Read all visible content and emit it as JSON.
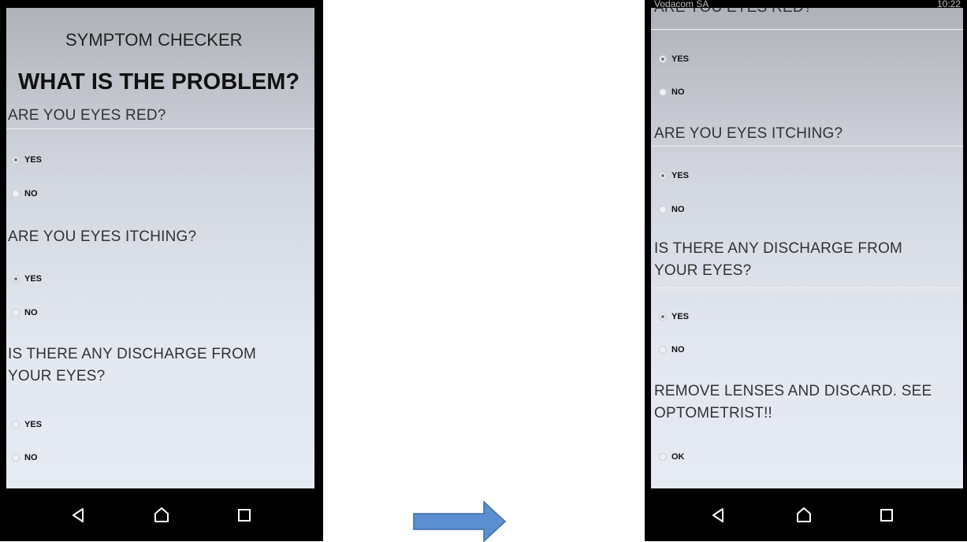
{
  "left_screen": {
    "app_title": "SYMPTOM CHECKER",
    "heading": "WHAT IS THE PROBLEM?",
    "q1": {
      "text": "ARE YOU EYES RED?",
      "opt_yes": "YES",
      "opt_no": "NO",
      "selected": "YES"
    },
    "q2": {
      "text": "ARE YOU EYES ITCHING?",
      "opt_yes": "YES",
      "opt_no": "NO",
      "selected": "YES"
    },
    "q3": {
      "text": "IS THERE ANY DISCHARGE FROM YOUR EYES?",
      "opt_yes": "YES",
      "opt_no": "NO",
      "selected": null
    }
  },
  "right_screen": {
    "status_bar": {
      "carrier": "Vodacom SA",
      "time": "10:22"
    },
    "q1": {
      "text": "ARE YOU EYES RED?",
      "opt_yes": "YES",
      "opt_no": "NO",
      "selected": "YES"
    },
    "q2": {
      "text": "ARE YOU EYES ITCHING?",
      "opt_yes": "YES",
      "opt_no": "NO",
      "selected": "YES"
    },
    "q3": {
      "text": "IS THERE ANY DISCHARGE FROM YOUR EYES?",
      "opt_yes": "YES",
      "opt_no": "NO",
      "selected": "YES"
    },
    "advice": {
      "text": "REMOVE LENSES AND DISCARD. SEE OPTOMETRIST!!",
      "opt_ok": "OK"
    }
  },
  "nav_icons": [
    "back-icon",
    "home-icon",
    "recents-icon"
  ],
  "colors": {
    "arrow_fill": "#5b8fd0",
    "arrow_stroke": "#3f6fa8",
    "nav_bar": "#000000"
  }
}
